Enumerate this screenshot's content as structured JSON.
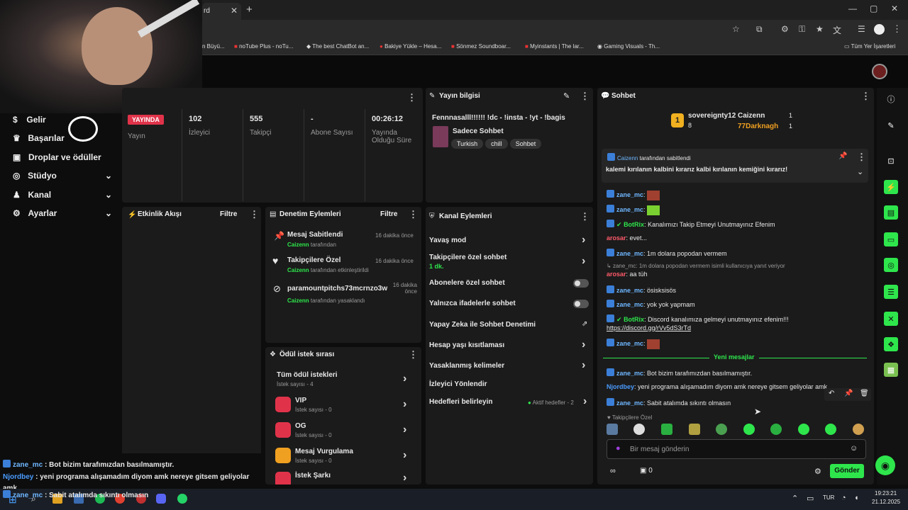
{
  "browser": {
    "tab_title": "rd",
    "bookmarks": [
      "n Büyü...",
      "noTube Plus - noTu...",
      "The best ChatBot an...",
      "Bakiye Yükle – Hesa...",
      "Sönmez Soundboar...",
      "Myinstants | The lar...",
      "Gaming Visuals - Th..."
    ],
    "all_bookmarks": "Tüm Yer İşaretleri"
  },
  "sidebar": {
    "items": [
      {
        "label": "Gelir",
        "icon": "dollar-icon"
      },
      {
        "label": "Başarılar",
        "icon": "trophy-icon"
      },
      {
        "label": "Droplar ve ödüller",
        "icon": "gift-icon"
      },
      {
        "label": "Stüdyo",
        "icon": "studio-icon"
      },
      {
        "label": "Kanal",
        "icon": "user-icon"
      },
      {
        "label": "Ayarlar",
        "icon": "gear-icon"
      }
    ]
  },
  "stats": {
    "live": "YAYINDA",
    "live_sub": "Yayın",
    "viewers": "102",
    "viewers_label": "İzleyici",
    "followers": "555",
    "followers_label": "Takipçi",
    "subs": "-",
    "subs_label": "Abone Sayısı",
    "uptime": "00:26:12",
    "uptime_label": "Yayında Olduğu Süre"
  },
  "activity": {
    "title": "Etkinlik Akışı",
    "filter": "Filtre"
  },
  "moderation": {
    "title": "Denetim Eylemleri",
    "filter": "Filtre",
    "items": [
      {
        "title": "Mesaj Sabitlendi",
        "user": "Caizenn",
        "detail": "tarafından",
        "time": "16 dakika önce"
      },
      {
        "title": "Takipçilere Özel",
        "user": "Caizenn",
        "detail": "tarafından etkinleştirildi",
        "time": "16 dakika önce"
      },
      {
        "title": "paramountpitchs73mcrnzo3w",
        "user": "Caizenn",
        "detail": "tarafından yasaklandı",
        "time": "16 dakika önce"
      }
    ]
  },
  "rewards": {
    "title": "Ödül istek sırası",
    "all": "Tüm ödül istekleri",
    "all_count": "İstek sayısı - 4",
    "items": [
      {
        "name": "VIP",
        "count": "İstek sayısı - 0",
        "color": "#e0334a"
      },
      {
        "name": "OG",
        "count": "İstek sayısı - 0",
        "color": "#e0334a"
      },
      {
        "name": "Mesaj Vurgulama",
        "count": "İstek sayısı - 0",
        "color": "#f0a020"
      },
      {
        "name": "İstek Şarkı",
        "count": "",
        "color": "#e0334a"
      }
    ]
  },
  "stream_info": {
    "title": "Yayın bilgisi",
    "stream_title": "Fennnasalll!!!!!! !dc - !insta - !yt - !bagis",
    "category": "Sadece Sohbet",
    "tags": [
      "Turkish",
      "chill",
      "Sohbet"
    ]
  },
  "channel_actions": {
    "title": "Kanal Eylemleri",
    "slow": "Yavaş mod",
    "followers_only": "Takipçilere özel sohbet",
    "followers_only_sub": "1 dk.",
    "subs_only": "Abonelere özel sohbet",
    "emote_only": "Yalnızca ifadelerle sohbet",
    "ai_mod": "Yapay Zeka ile Sohbet Denetimi",
    "age": "Hesap yaşı kısıtlaması",
    "banned": "Yasaklanmış kelimeler",
    "raid": "İzleyici Yönlendir",
    "goals": "Hedefleri belirleyin",
    "goals_badge": "Aktif hedefler - 2"
  },
  "chat": {
    "title": "Sohbet",
    "leaderboard": [
      {
        "name": "sovereignty12",
        "count": "8"
      },
      {
        "name": "Caizenn",
        "count": "1"
      },
      {
        "name": "77Darknagh",
        "count": "1"
      }
    ],
    "pinned_by": "Caizenn",
    "pinned_by_suffix": "tarafından sabitlendi",
    "pinned_text": "kalemi kırılanın kalbini kırarız kalbi kırılanın kemiğini kırarız!",
    "messages": [
      {
        "user": "zane_mc",
        "text": ""
      },
      {
        "user": "zane_mc",
        "text": ""
      },
      {
        "user": "BotRix",
        "text": "Kanalımızı Takip Etmeyi Unutmayınız Efenim"
      },
      {
        "user": "arosar",
        "text": "evet..."
      },
      {
        "user": "zane_mc",
        "text": "1m dolara popodan vermem"
      },
      {
        "user": "",
        "text": "zane_mc: 1m dolara popodan vermem isimli kullanıcıya yanıt veriyor"
      },
      {
        "user": "arosar",
        "text": "aa tüh"
      },
      {
        "user": "zane_mc",
        "text": "ösisksisös"
      },
      {
        "user": "zane_mc",
        "text": "yok yok yapmam"
      },
      {
        "user": "BotRix",
        "text": "Discord kanalımıza gelmeyi unutmayınız efenim!!!"
      },
      {
        "user": "",
        "text": "https://discord.gg/rVv5dS3rTd"
      },
      {
        "user": "zane_mc",
        "text": ""
      }
    ],
    "new_messages": "Yeni mesajlar",
    "new": [
      {
        "user": "zane_mc",
        "text": "Bot bizim tarafımızdan basılmamıştır."
      },
      {
        "user": "Njordbey",
        "text": "yeni programa alışamadım diyom amk nereye gitsem geliyolar amk"
      },
      {
        "user": "zane_mc",
        "text": "Sabit atalımda sıkıntı olmasın"
      }
    ],
    "followers_only": "Takipçilere Özel",
    "placeholder": "Bir mesaj gönderin",
    "send": "Gönder",
    "points": "0"
  },
  "overlay": [
    {
      "user": "zane_mc",
      "text": "Bot bizim tarafımızdan basılmamıştır."
    },
    {
      "user": "Njordbey",
      "text": "yeni programa alışamadım diyom amk nereye gitsem geliyolar"
    },
    {
      "user": "",
      "text": "amk"
    },
    {
      "user": "zane_mc",
      "text": "Sabit atalımda sıkıntı olmasın"
    }
  ],
  "taskbar": {
    "lang": "TUR",
    "time": "19:23:21",
    "date": "21.12.2025"
  }
}
